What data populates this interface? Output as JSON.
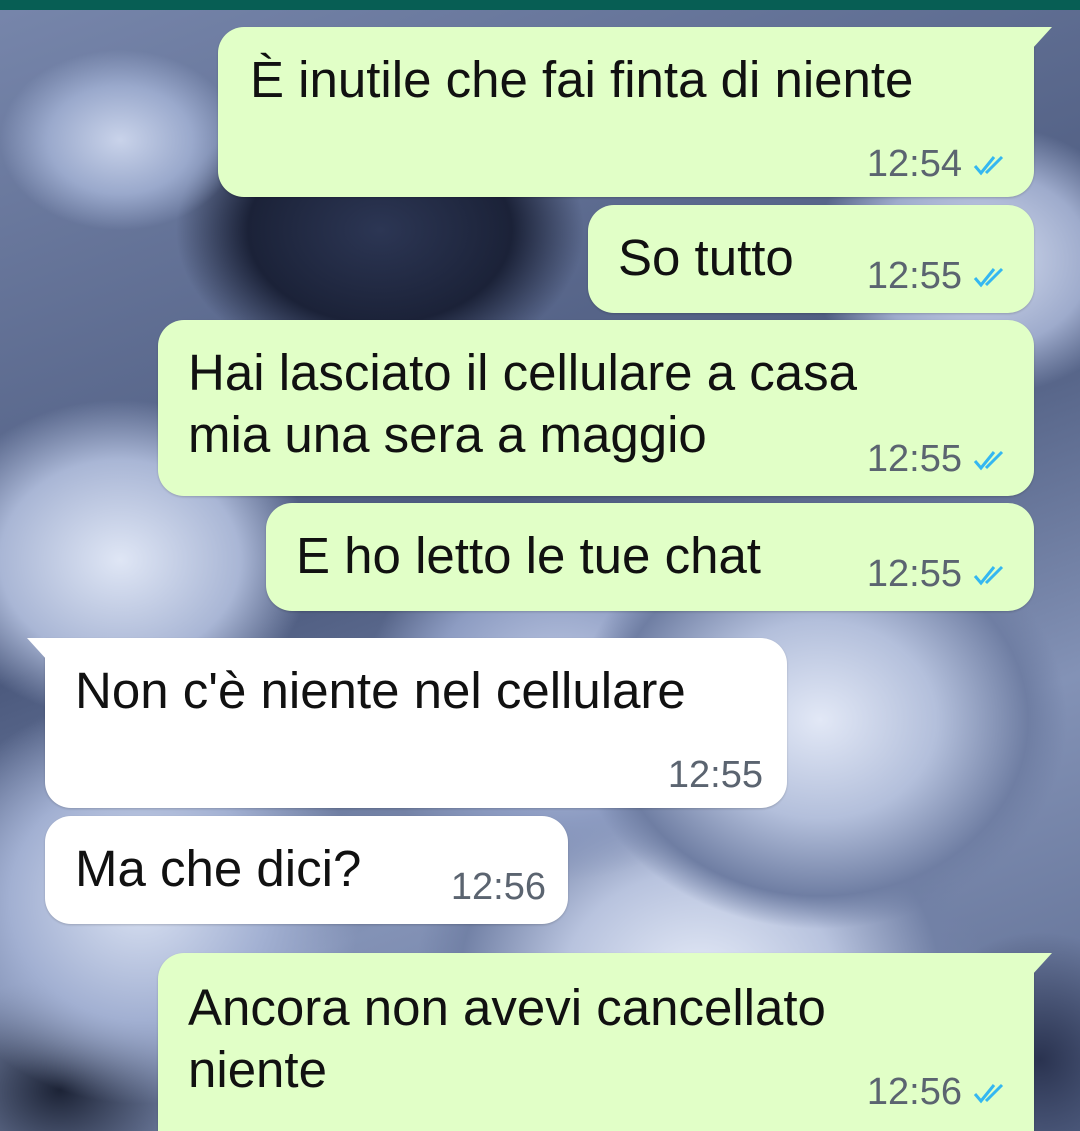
{
  "app": {
    "accent_color": "#075e54"
  },
  "colors": {
    "outgoing_bubble": "#e1ffc7",
    "incoming_bubble": "#ffffff",
    "read_ticks": "#34b7f1"
  },
  "messages": [
    {
      "direction": "outgoing",
      "text": "È inutile che fai finta di niente",
      "time": "12:54",
      "status": "read",
      "status_icon": "double-check-icon"
    },
    {
      "direction": "outgoing",
      "text": "So tutto",
      "time": "12:55",
      "status": "read",
      "status_icon": "double-check-icon"
    },
    {
      "direction": "outgoing",
      "text": "Hai lasciato il cellulare a casa\nmia una sera a maggio",
      "time": "12:55",
      "status": "read",
      "status_icon": "double-check-icon"
    },
    {
      "direction": "outgoing",
      "text": "E ho letto le tue chat",
      "time": "12:55",
      "status": "read",
      "status_icon": "double-check-icon"
    },
    {
      "direction": "incoming",
      "text": "Non c'è niente nel cellulare",
      "time": "12:55"
    },
    {
      "direction": "incoming",
      "text": "Ma che dici?",
      "time": "12:56"
    },
    {
      "direction": "outgoing",
      "text": "Ancora non avevi cancellato\nniente",
      "time": "12:56",
      "status": "read",
      "status_icon": "double-check-icon"
    }
  ]
}
